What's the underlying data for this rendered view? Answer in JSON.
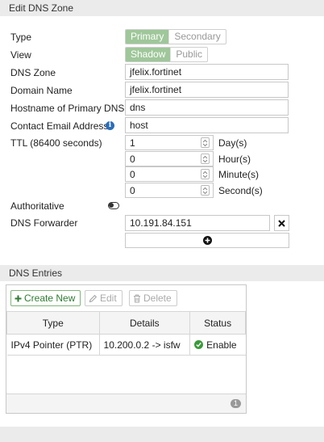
{
  "header": {
    "title": "Edit DNS Zone"
  },
  "form": {
    "type": {
      "label": "Type",
      "options": [
        "Primary",
        "Secondary"
      ],
      "selected": "Primary"
    },
    "view": {
      "label": "View",
      "options": [
        "Shadow",
        "Public"
      ],
      "selected": "Shadow"
    },
    "dns_zone": {
      "label": "DNS Zone",
      "value": "jfelix.fortinet"
    },
    "domain_name": {
      "label": "Domain Name",
      "value": "jfelix.fortinet"
    },
    "hostname": {
      "label": "Hostname of Primary DNS",
      "value": "dns"
    },
    "contact_email": {
      "label": "Contact Email Address",
      "value": "host"
    },
    "ttl": {
      "label": "TTL (86400 seconds)",
      "fields": [
        {
          "value": "1",
          "unit": "Day(s)"
        },
        {
          "value": "0",
          "unit": "Hour(s)"
        },
        {
          "value": "0",
          "unit": "Minute(s)"
        },
        {
          "value": "0",
          "unit": "Second(s)"
        }
      ]
    },
    "authoritative": {
      "label": "Authoritative",
      "enabled": false
    },
    "dns_forwarder": {
      "label": "DNS Forwarder",
      "value": "10.191.84.151"
    }
  },
  "dns_entries": {
    "title": "DNS Entries",
    "toolbar": {
      "create": "Create New",
      "edit": "Edit",
      "delete": "Delete"
    },
    "columns": [
      "Type",
      "Details",
      "Status"
    ],
    "rows": [
      {
        "type": "IPv4 Pointer (PTR)",
        "details": "10.200.0.2 -> isfw",
        "status": "Enable"
      }
    ],
    "count": "1"
  },
  "colors": {
    "segment_active": "#9fc79a",
    "status_enabled": "#3a9a3a",
    "info": "#2c6db8",
    "create_button": "#2e7d32"
  }
}
